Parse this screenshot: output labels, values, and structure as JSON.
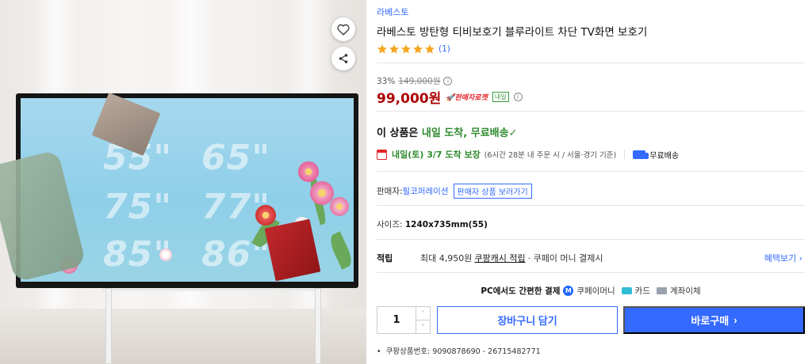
{
  "product": {
    "brand": "라베스토",
    "title": "라베스토 방탄형 티비보호기 블루라이트 차단 TV화면 보호기",
    "rating_stars": 5,
    "review_count": "(1)"
  },
  "pricing": {
    "discount_rate": "33%",
    "original_price": "149,000원",
    "price": "99,000원",
    "rocket_badge": "판매자로켓",
    "naeil_badge": "내일"
  },
  "delivery": {
    "headline_prefix": "이 상품은 ",
    "headline_highlight": "내일 도착, 무료배송",
    "headline_check": "✓",
    "date_text": "내일(토) 3/7 도착 보장",
    "condition_text": "(6시간 28분 내 주문 시 / 서울·경기 기준)",
    "free_shipping": "무료배송"
  },
  "seller": {
    "label": "판매자: ",
    "name": "필코퍼레이션",
    "view_products_button": "판매자 상품 보러가기"
  },
  "option": {
    "label": "사이즈: ",
    "value": "1240x735mm(55)"
  },
  "points": {
    "label": "적립",
    "text_before": "최대 4,950원 ",
    "link_text": "쿠팡캐시 적립",
    "text_after": "· 쿠페이 머니 결제시",
    "benefit_link": "혜택보기 ›"
  },
  "payment": {
    "headline": "PC에서도 간편한 결제",
    "coupay_icon": "M",
    "coupay": "쿠페이머니",
    "card": "카드",
    "bank": "계좌이체"
  },
  "purchase": {
    "quantity": "1",
    "up_arrow": "˄",
    "down_arrow": "˅",
    "cart_button": "장바구니 담기",
    "buy_button": "바로구매",
    "buy_chevron": "›"
  },
  "product_number": "쿠팡상품번호: 9090878690 - 26715482771",
  "gallery": {
    "size_labels": [
      "55\"",
      "65\"",
      "75\"",
      "77\"",
      "85\"",
      "86\""
    ],
    "icons": {
      "wish": "heart-icon",
      "share": "share-icon"
    }
  },
  "colors": {
    "accent": "#346aff",
    "price": "#ae0000",
    "delivery_green": "#2f8a2f",
    "star": "#f5a623"
  }
}
